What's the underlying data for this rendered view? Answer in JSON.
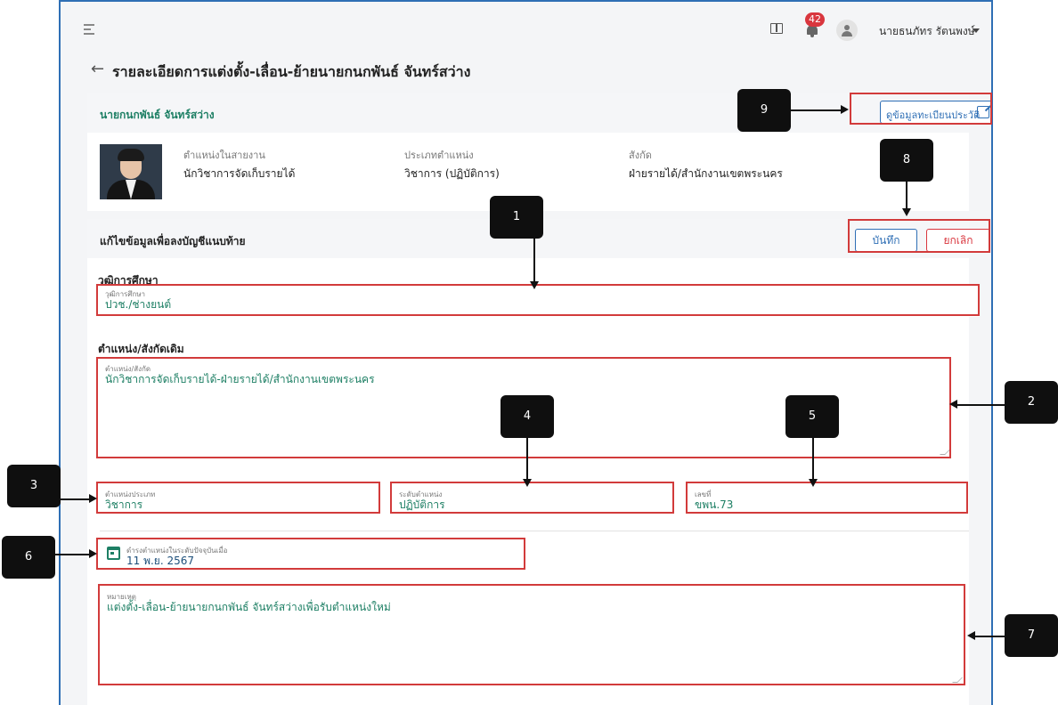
{
  "topbar": {
    "notification_count": "42",
    "user_name": "นายธนภัทร รัตนพงษ์"
  },
  "page": {
    "title": "รายละเอียดการแต่งตั้ง-เลื่อน-ย้ายนายกนกพันธ์ จันทร์สว่าง"
  },
  "person": {
    "name": "นายกนกพันธ์ จันทร์สว่าง",
    "profile_link_label": "ดูข้อมูลทะเบียนประวัติ",
    "position_label": "ตำแหน่งในสายงาน",
    "position_value": "นักวิชาการจัดเก็บรายได้",
    "type_label": "ประเภทตำแหน่ง",
    "type_value": "วิชาการ (ปฏิบัติการ)",
    "affiliation_label": "สังกัด",
    "affiliation_value": "ฝ่ายรายได้/สำนักงานเขตพระนคร"
  },
  "edit": {
    "title": "แก้ไขข้อมูลเพื่อลงบัญชีแนบท้าย",
    "save_label": "บันทึก",
    "cancel_label": "ยกเลิก",
    "education_section": "วุฒิการศึกษา",
    "education_label": "วุฒิการศึกษา",
    "education_value": "ปวช./ช่างยนต์",
    "position_section": "ตำแหน่ง/สังกัดเดิม",
    "position_label": "ตำแหน่ง/สังกัด",
    "position_value": "นักวิชาการจัดเก็บรายได้-ฝ่ายรายได้/สำนักงานเขตพระนคร",
    "position_type_label": "ตำแหน่งประเภท",
    "position_type_value": "วิชาการ",
    "level_label": "ระดับตำแหน่ง",
    "level_value": "ปฏิบัติการ",
    "number_label": "เลขที่",
    "number_value": "ขพน.73",
    "date_label": "ดำรงตำแหน่งในระดับปัจจุบันเมื่อ",
    "date_value": "11 พ.ย. 2567",
    "remark_label": "หมายเหตุ",
    "remark_value": "แต่งตั้ง-เลื่อน-ย้ายนายกนกพันธ์ จันทร์สว่างเพื่อรับตำแหน่งใหม่"
  },
  "annotations": [
    "1",
    "2",
    "3",
    "4",
    "5",
    "6",
    "7",
    "8",
    "9"
  ],
  "colors": {
    "accent_blue": "#2f6fb5",
    "value_green": "#1d7f64",
    "cancel_red": "#d9363e",
    "annotation_red": "#d23b3b",
    "badge_red": "#d9363e"
  }
}
